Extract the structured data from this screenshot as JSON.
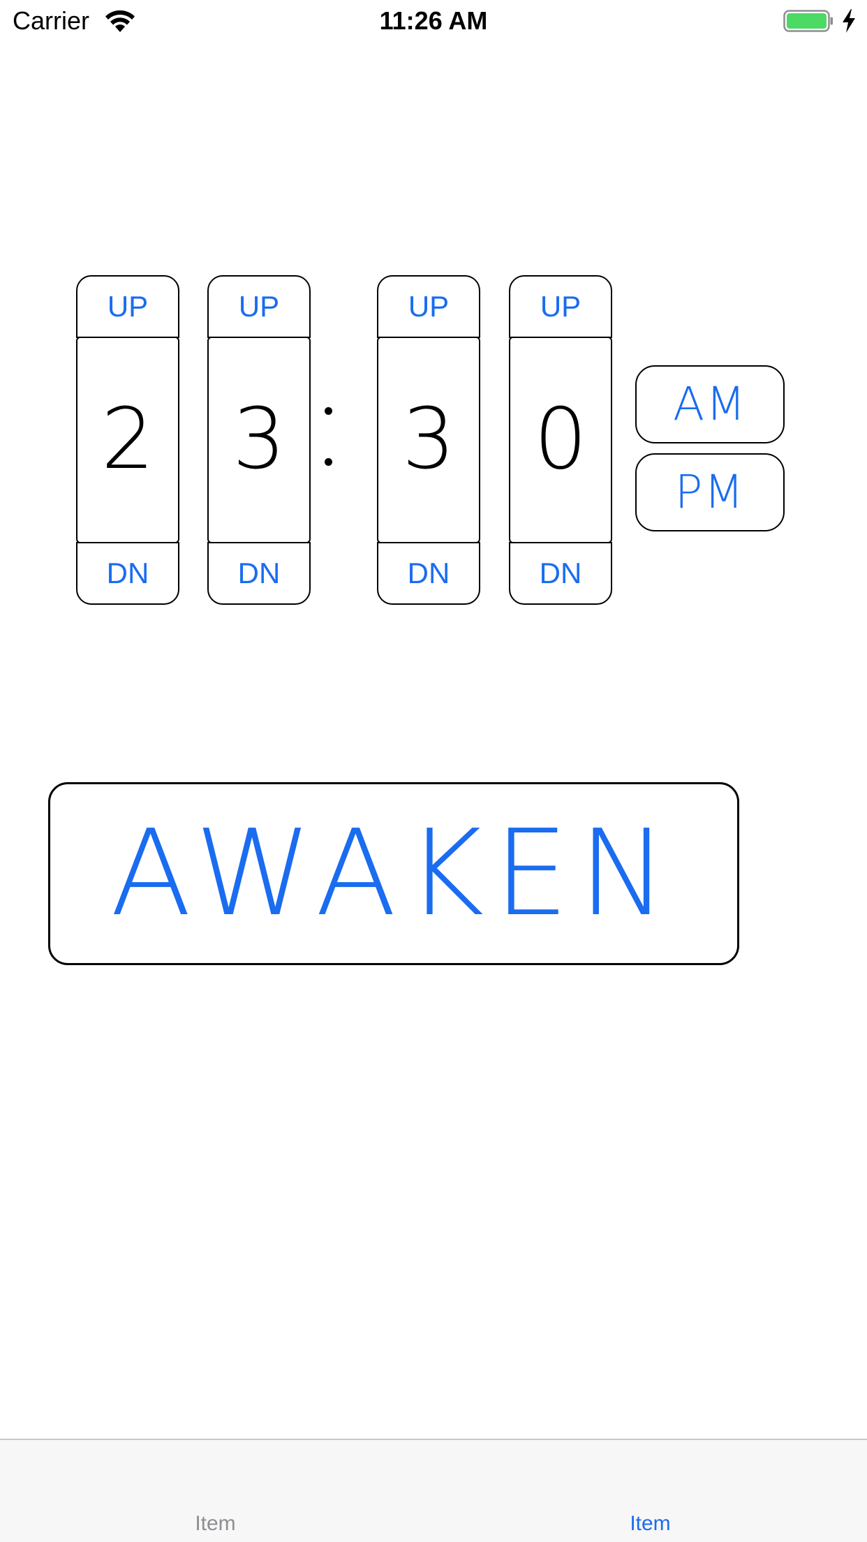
{
  "status_bar": {
    "carrier": "Carrier",
    "time": "11:26 AM",
    "wifi_icon": "wifi-icon",
    "battery_icon": "battery-icon",
    "charging_icon": "charging-bolt-icon",
    "battery_color": "#4cd964"
  },
  "time_picker": {
    "up_label": "UP",
    "down_label": "DN",
    "digits": [
      "2",
      "3",
      "3",
      "0"
    ],
    "am_label": "AM",
    "pm_label": "PM"
  },
  "awaken": {
    "label": "AWAKEN"
  },
  "tab_bar": {
    "tabs": [
      {
        "label": "Item",
        "selected": false
      },
      {
        "label": "Item",
        "selected": true
      }
    ]
  },
  "colors": {
    "accent": "#1a6cf0",
    "border": "#000000",
    "tab_inactive": "#8e8e93",
    "tab_bar_bg": "#f7f7f7"
  }
}
